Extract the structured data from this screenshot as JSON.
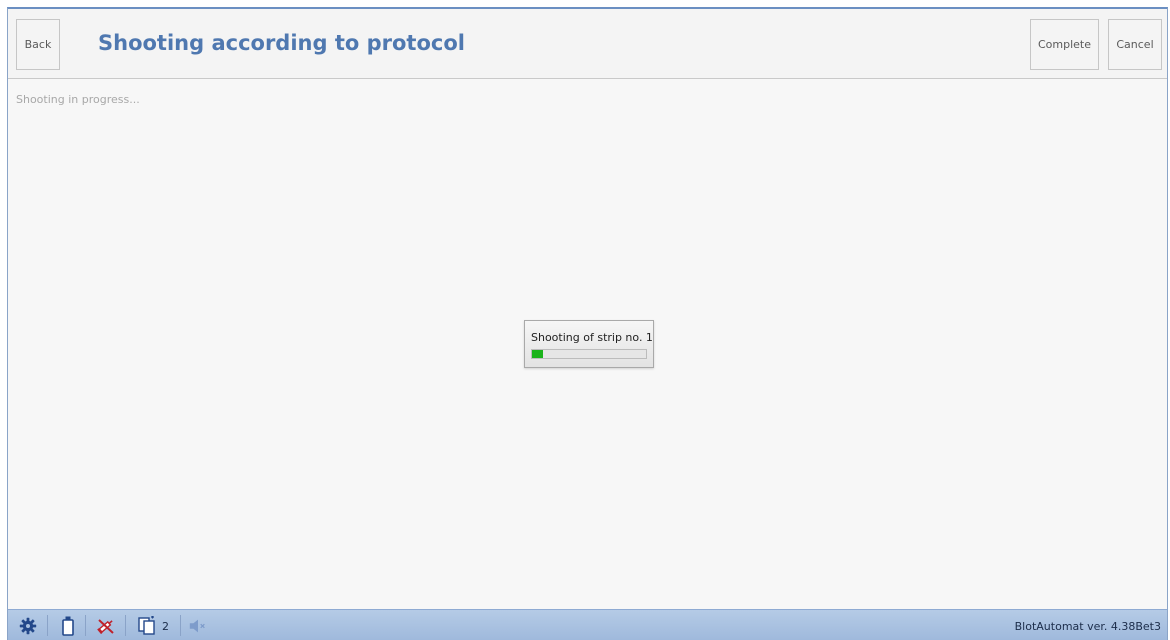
{
  "header": {
    "back_label": "Back",
    "title": "Shooting according to protocol",
    "complete_label": "Complete",
    "cancel_label": "Cancel"
  },
  "main": {
    "status_text": "Shooting in progress..."
  },
  "progress": {
    "label": "Shooting of strip no. 1",
    "fraction": 0.1,
    "fill_color": "#1bb31b"
  },
  "footer": {
    "icons": [
      "gear-icon",
      "bottle-icon",
      "syringe-disabled-icon",
      "documents-icon",
      "speaker-muted-icon"
    ],
    "document_count": "2",
    "version": "BlotAutomat ver. 4.38Bet3"
  },
  "colors": {
    "title": "#4f78b0",
    "window_border": "#6b8fc2",
    "status_bar": "#a9c1e1",
    "disabled_icon": "#c0212b"
  }
}
